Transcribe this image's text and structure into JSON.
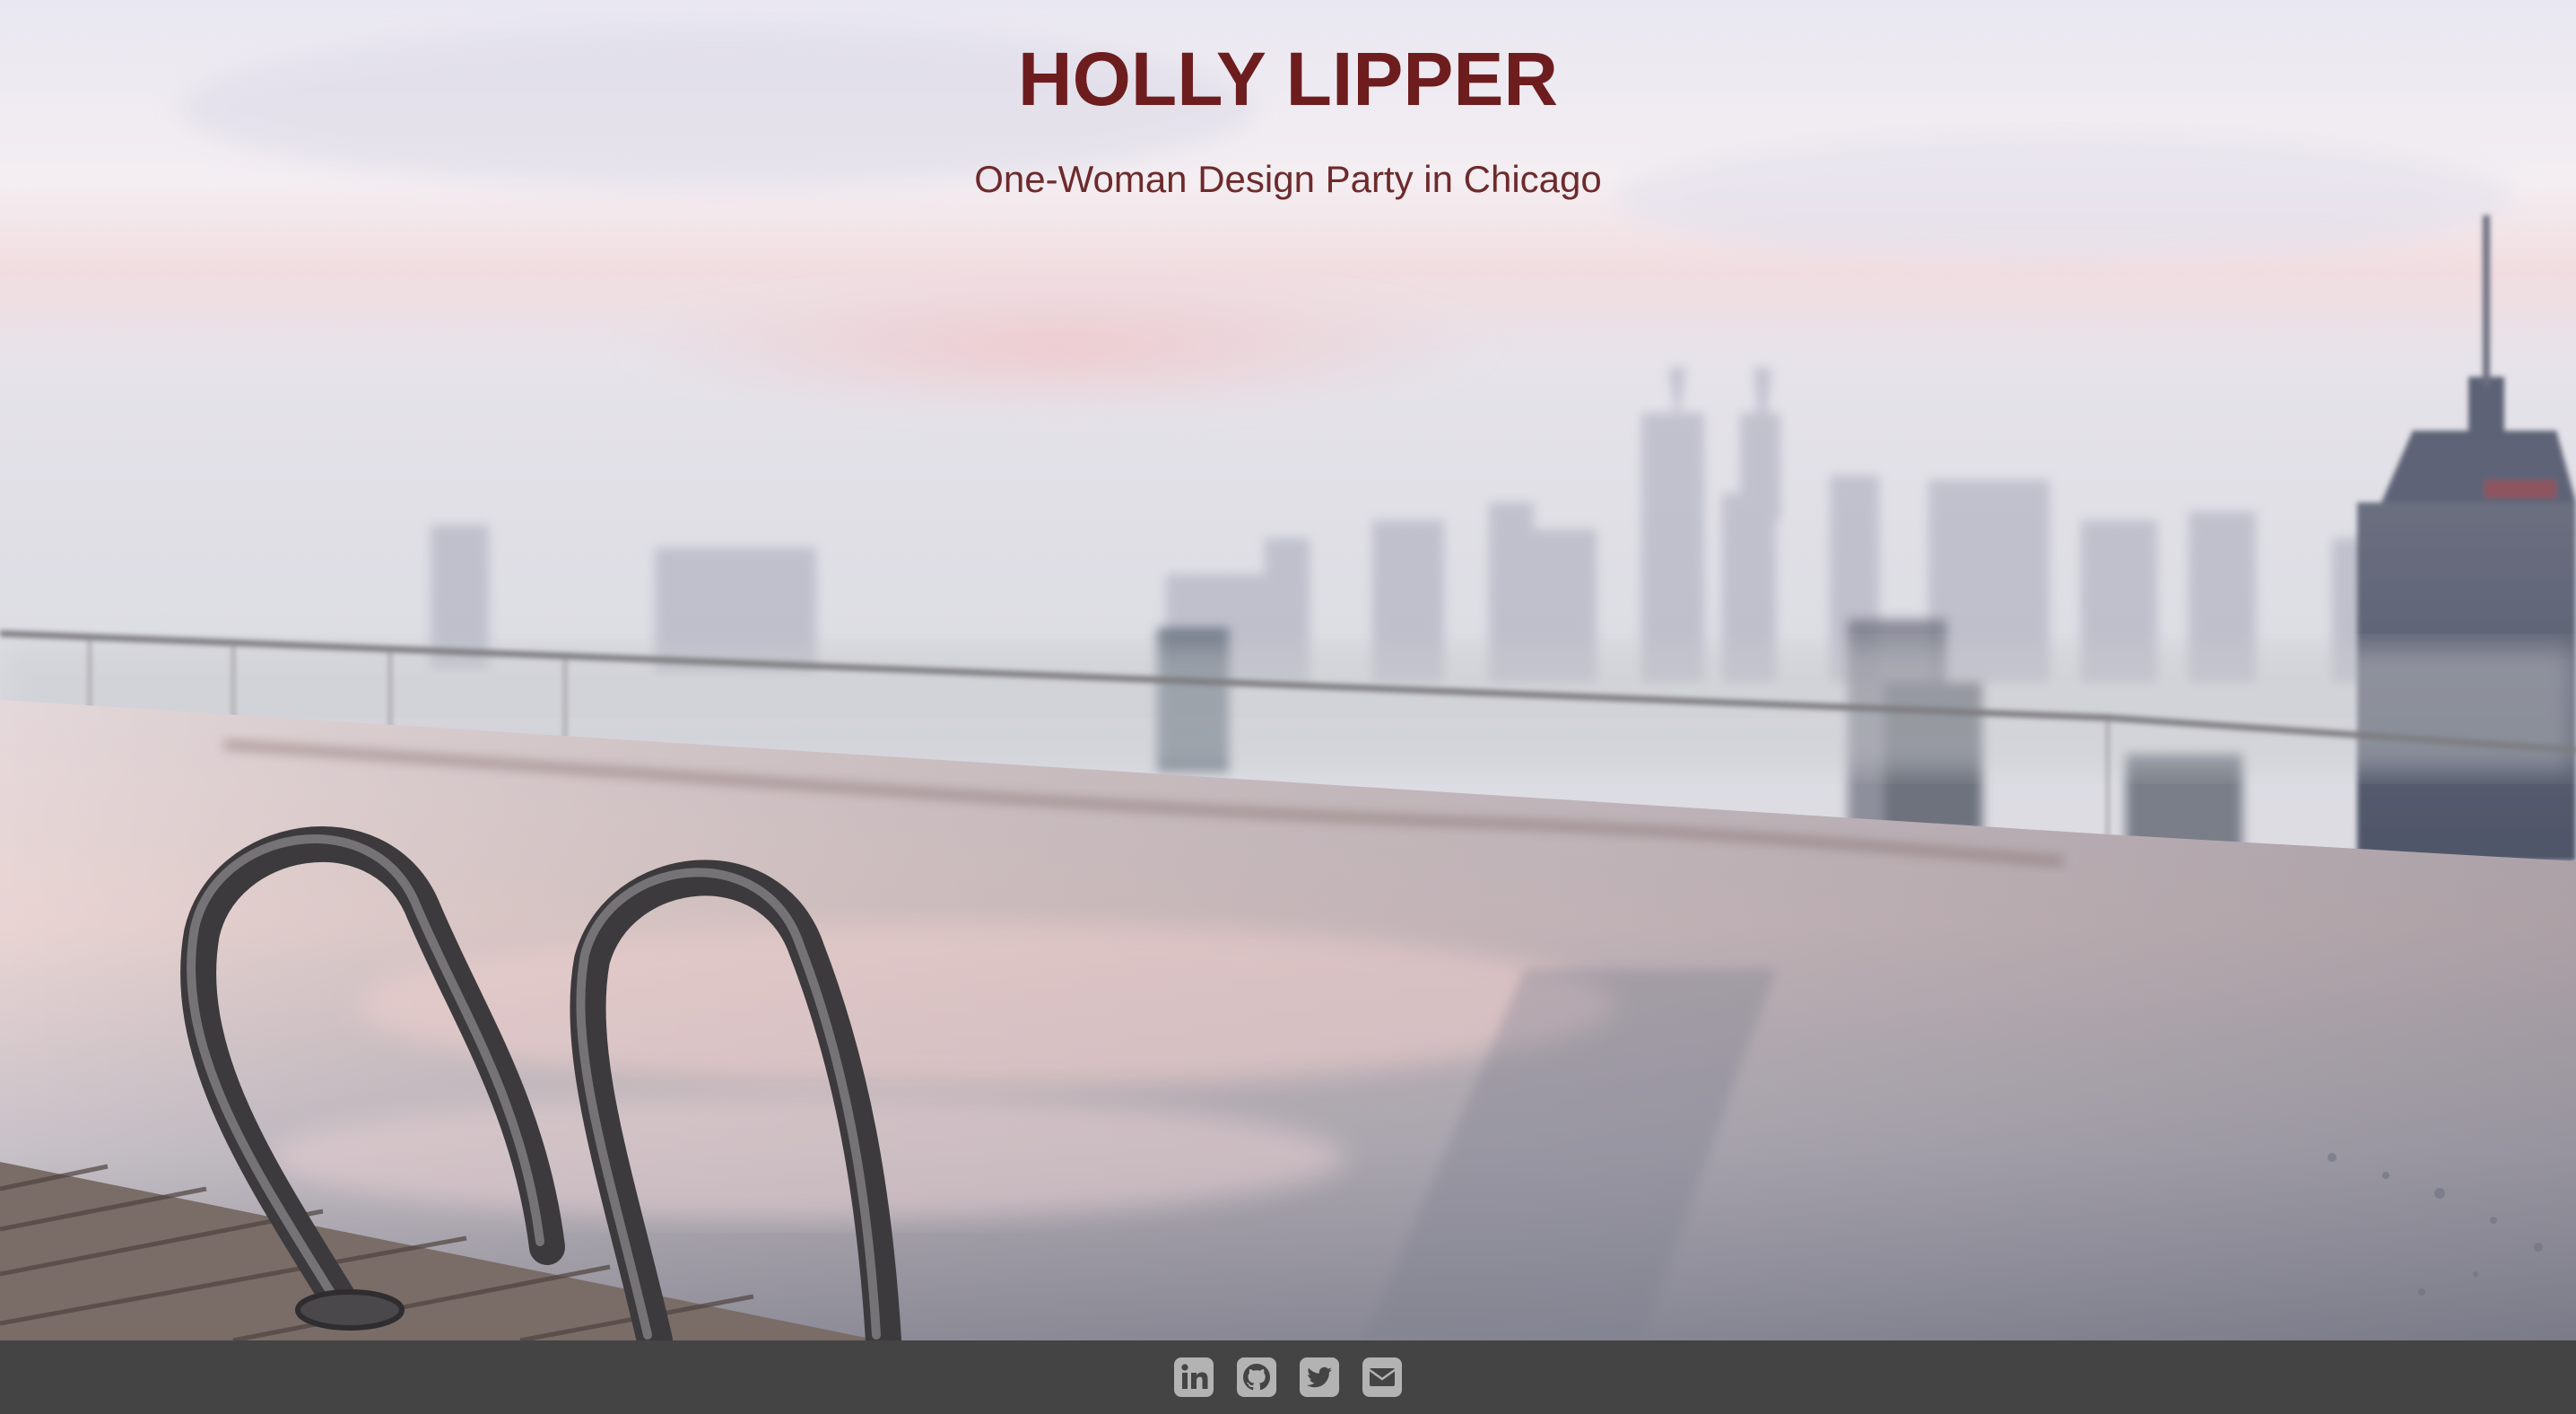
{
  "header": {
    "title": "HOLLY LIPPER",
    "subtitle": "One-Woman Design Party in Chicago"
  },
  "hero": {
    "background_description_icon": "city-rooftop-pool-image"
  },
  "footer": {
    "background_color": "#444444",
    "icon_color": "#b3b3b3",
    "social_links": [
      {
        "icon": "linkedin-icon"
      },
      {
        "icon": "github-icon"
      },
      {
        "icon": "twitter-icon"
      },
      {
        "icon": "email-icon"
      }
    ]
  },
  "colors": {
    "title": "#6e1d1f",
    "subtitle": "#6e2a2c"
  }
}
